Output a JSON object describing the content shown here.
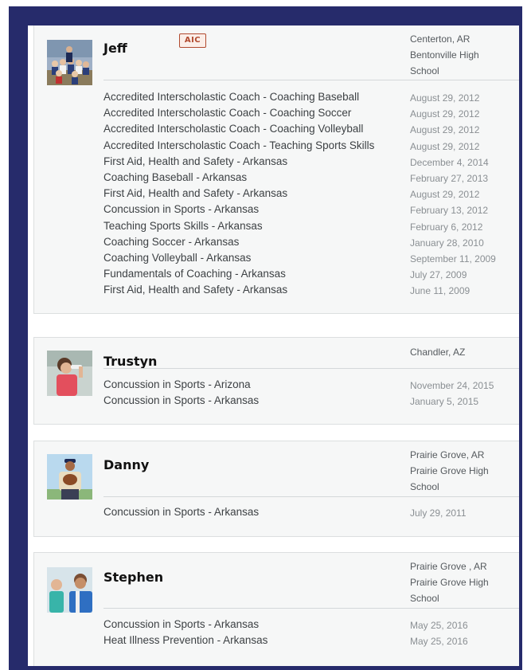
{
  "coaches": [
    {
      "name": "Jeff",
      "badge": "AIC",
      "location": [
        "Centerton, AR",
        "Bentonville High",
        "School"
      ],
      "credentials": [
        {
          "title": "Accredited Interscholastic Coach - Coaching Baseball",
          "date": "August 29, 2012"
        },
        {
          "title": "Accredited Interscholastic Coach - Coaching Soccer",
          "date": "August 29, 2012"
        },
        {
          "title": "Accredited Interscholastic Coach - Coaching Volleyball",
          "date": "August 29, 2012"
        },
        {
          "title": "Accredited Interscholastic Coach - Teaching Sports Skills",
          "date": "August 29, 2012"
        },
        {
          "title": "First Aid, Health and Safety - Arkansas",
          "date": "December 4, 2014"
        },
        {
          "title": "Coaching Baseball - Arkansas",
          "date": "February 27, 2013"
        },
        {
          "title": "First Aid, Health and Safety - Arkansas",
          "date": "August 29, 2012"
        },
        {
          "title": "Concussion in Sports - Arkansas",
          "date": "February 13, 2012"
        },
        {
          "title": "Teaching Sports Skills - Arkansas",
          "date": "February 6, 2012"
        },
        {
          "title": "Coaching Soccer - Arkansas",
          "date": "January 28, 2010"
        },
        {
          "title": "Coaching Volleyball - Arkansas",
          "date": "September 11, 2009"
        },
        {
          "title": "Fundamentals of Coaching - Arkansas",
          "date": "July 27, 2009"
        },
        {
          "title": "First Aid, Health and Safety - Arkansas",
          "date": "June 11, 2009"
        }
      ]
    },
    {
      "name": "Trustyn",
      "location": [
        "Chandler, AZ"
      ],
      "credentials": [
        {
          "title": "Concussion in Sports - Arizona",
          "date": "November 24, 2015"
        },
        {
          "title": "Concussion in Sports - Arkansas",
          "date": "January 5, 2015"
        }
      ]
    },
    {
      "name": "Danny",
      "location": [
        "Prairie Grove, AR",
        "Prairie Grove High",
        "School"
      ],
      "credentials": [
        {
          "title": "Concussion in Sports - Arkansas",
          "date": "July 29, 2011"
        }
      ]
    },
    {
      "name": "Stephen",
      "location": [
        "Prairie Grove , AR",
        "Prairie Grove High",
        "School"
      ],
      "credentials": [
        {
          "title": "Concussion in Sports - Arkansas",
          "date": "May 25, 2016"
        },
        {
          "title": "Heat Illness Prevention - Arkansas",
          "date": "May 25, 2016"
        }
      ]
    }
  ]
}
